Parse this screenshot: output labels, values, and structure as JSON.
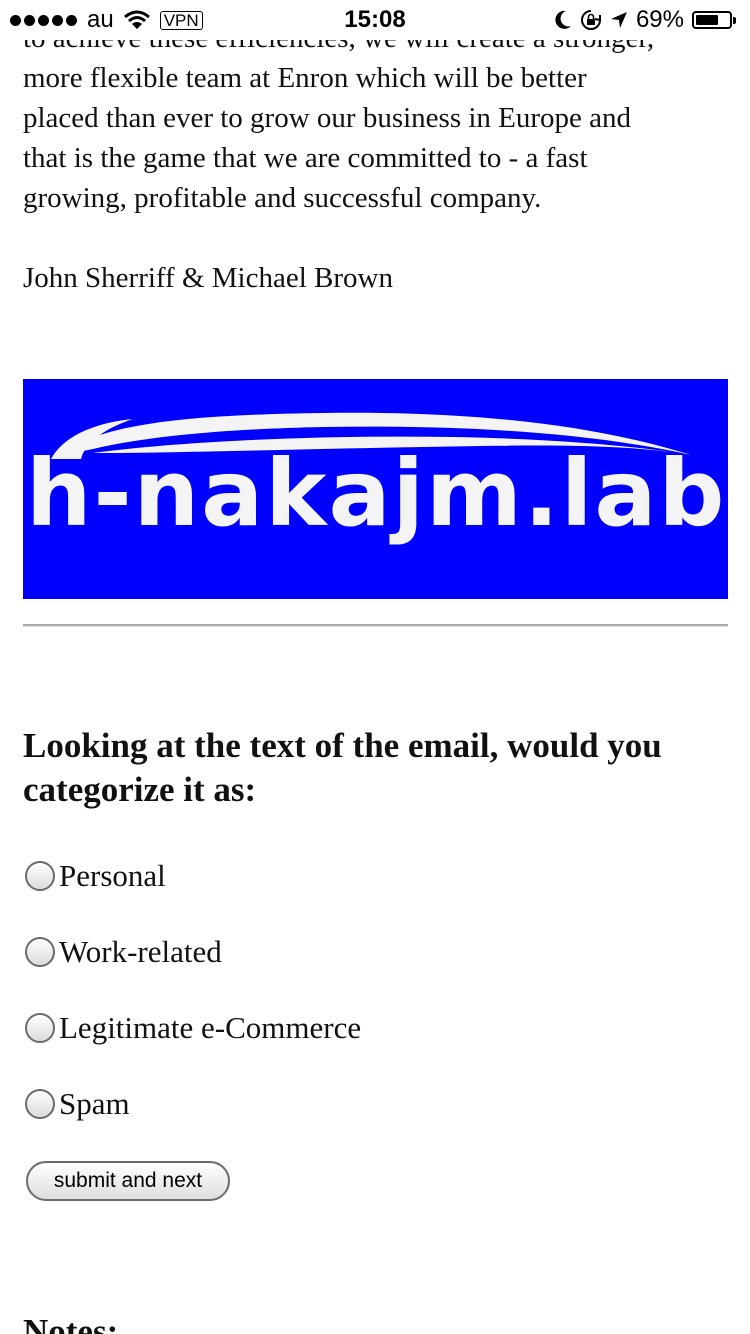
{
  "status_bar": {
    "carrier": "au",
    "vpn": "VPN",
    "time": "15:08",
    "battery": "69%",
    "battery_level": 0.69,
    "icons": [
      "signal-dots-icon",
      "wifi-icon",
      "moon-icon",
      "rotation-lock-icon",
      "location-arrow-icon",
      "battery-icon"
    ]
  },
  "email": {
    "paragraph_lines": [
      "to achieve these efficiencies, we will create a stronger,",
      "more flexible team at Enron which will be better",
      "placed than ever to grow our business in Europe and",
      "that is the game that we are committed to - a fast",
      "growing, profitable and successful company."
    ],
    "signature": "John Sherriff & Michael Brown"
  },
  "logo": {
    "text": "h-nakajm.lab",
    "background": "#0000ff"
  },
  "question": {
    "text": "Looking at the text of the email, would you categorize it as:",
    "options": [
      {
        "label": "Personal",
        "selected": false
      },
      {
        "label": "Work-related",
        "selected": false
      },
      {
        "label": "Legitimate e-Commerce",
        "selected": false
      },
      {
        "label": "Spam",
        "selected": false
      }
    ]
  },
  "submit": {
    "label": "submit and next"
  },
  "notes": {
    "heading": "Notes:"
  }
}
